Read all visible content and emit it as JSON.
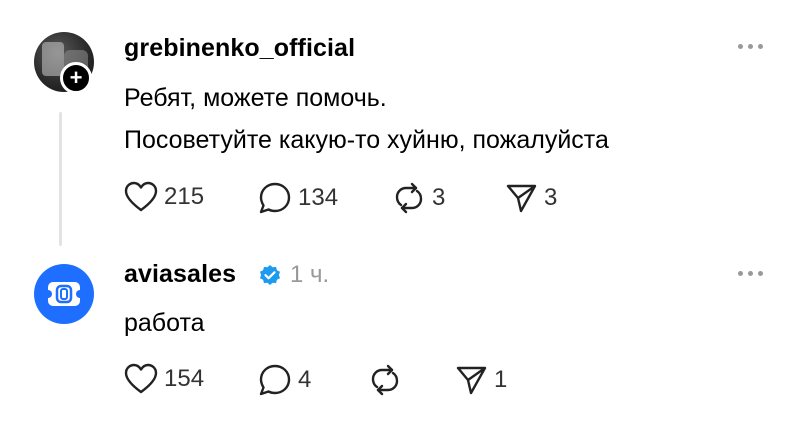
{
  "post1": {
    "username": "grebinenko_official",
    "lines": [
      "Ребят, можете помочь.",
      "Посоветуйте какую-то хуйню, пожалуйста"
    ],
    "likes": "215",
    "comments": "134",
    "reposts": "3",
    "shares": "3",
    "follow_icon": "plus-icon"
  },
  "post2": {
    "username": "aviasales",
    "timestamp": "1 ч.",
    "text": "работа",
    "likes": "154",
    "comments": "4",
    "reposts": "",
    "shares": "1",
    "verified_icon": "verified-badge-icon",
    "brand_color": "#1E6FFF"
  },
  "colors": {
    "verified": "#1D9BF0",
    "muted": "#999999",
    "thread_line": "#E3E3E3"
  }
}
